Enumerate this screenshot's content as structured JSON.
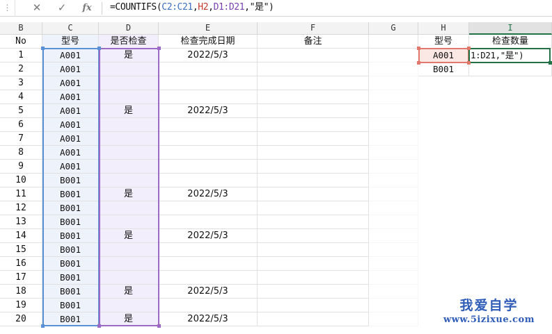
{
  "formula_bar": {
    "grip": "⋮",
    "cancel_icon": "✕",
    "enter_icon": "✓",
    "fx_label": "fx",
    "formula_parts": [
      {
        "text": "=COUNTIFS(",
        "color": "#111111"
      },
      {
        "text": "C2:C21",
        "color": "#3b6fc0"
      },
      {
        "text": ",",
        "color": "#111111"
      },
      {
        "text": "H2",
        "color": "#c0392b"
      },
      {
        "text": ",",
        "color": "#111111"
      },
      {
        "text": "D1:D21",
        "color": "#7a3fb0"
      },
      {
        "text": ",\"是\")",
        "color": "#111111"
      }
    ]
  },
  "sheet": {
    "columns": [
      "B",
      "C",
      "D",
      "E",
      "F",
      "",
      "G",
      "H",
      "I"
    ],
    "active_column": "I",
    "header_row": [
      "No",
      "型号",
      "是否检查",
      "检查完成日期",
      "备注"
    ],
    "rows": [
      {
        "no": "1",
        "model": "A001",
        "checked": "是",
        "date": "2022/5/3"
      },
      {
        "no": "2",
        "model": "A001",
        "checked": "",
        "date": ""
      },
      {
        "no": "3",
        "model": "A001",
        "checked": "",
        "date": ""
      },
      {
        "no": "4",
        "model": "A001",
        "checked": "",
        "date": ""
      },
      {
        "no": "5",
        "model": "A001",
        "checked": "是",
        "date": "2022/5/3"
      },
      {
        "no": "6",
        "model": "A001",
        "checked": "",
        "date": ""
      },
      {
        "no": "7",
        "model": "A001",
        "checked": "",
        "date": ""
      },
      {
        "no": "8",
        "model": "A001",
        "checked": "",
        "date": ""
      },
      {
        "no": "9",
        "model": "A001",
        "checked": "",
        "date": ""
      },
      {
        "no": "10",
        "model": "B001",
        "checked": "",
        "date": ""
      },
      {
        "no": "11",
        "model": "B001",
        "checked": "是",
        "date": "2022/5/3"
      },
      {
        "no": "12",
        "model": "B001",
        "checked": "",
        "date": ""
      },
      {
        "no": "13",
        "model": "B001",
        "checked": "",
        "date": ""
      },
      {
        "no": "14",
        "model": "B001",
        "checked": "是",
        "date": "2022/5/3"
      },
      {
        "no": "15",
        "model": "B001",
        "checked": "",
        "date": ""
      },
      {
        "no": "16",
        "model": "B001",
        "checked": "",
        "date": ""
      },
      {
        "no": "17",
        "model": "B001",
        "checked": "",
        "date": ""
      },
      {
        "no": "18",
        "model": "B001",
        "checked": "是",
        "date": "2022/5/3"
      },
      {
        "no": "19",
        "model": "B001",
        "checked": "",
        "date": ""
      },
      {
        "no": "20",
        "model": "B001",
        "checked": "是",
        "date": "2022/5/3"
      }
    ],
    "summary": {
      "headers": [
        "型号",
        "检查数量"
      ],
      "models": [
        "A001",
        "B001"
      ],
      "editing_text": "1:D21,\"是\")"
    }
  },
  "watermark": {
    "line1": "我爱自学",
    "line2": "www.5izixue.com"
  }
}
